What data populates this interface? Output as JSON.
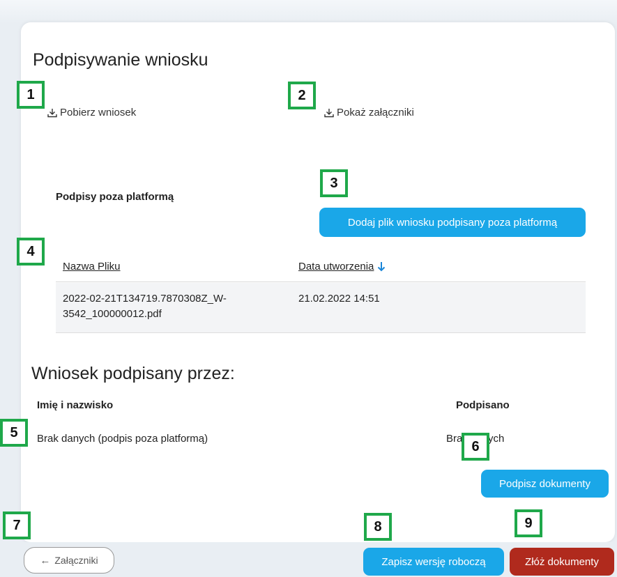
{
  "page": {
    "title": "Podpisywanie wniosku"
  },
  "downloads": {
    "download_application": "Pobierz wniosek",
    "show_attachments": "Pokaż załączniki"
  },
  "outside_signatures": {
    "label": "Podpisy poza platformą",
    "add_button": "Dodaj plik wniosku podpisany poza platformą"
  },
  "files_table": {
    "columns": [
      "Nazwa Pliku",
      "Data utworzenia"
    ],
    "rows": [
      {
        "name_line1": "2022-02-21T134719.7870308Z_W-",
        "name_line2": "3542_100000012.pdf",
        "date": "21.02.2022 14:51"
      }
    ]
  },
  "signed_by": {
    "title": "Wniosek podpisany przez:",
    "col_name": "Imię i nazwisko",
    "col_signed": "Podpisano",
    "row_name": "Brak danych (podpis poza platformą)",
    "row_signed": "Brak danych",
    "sign_button": "Podpisz dokumenty"
  },
  "footer": {
    "back_button": "Załączniki",
    "save_draft_button": "Zapisz wersję roboczą",
    "submit_button": "Złóż dokumenty"
  },
  "markers": [
    "1",
    "2",
    "3",
    "4",
    "5",
    "6",
    "7",
    "8",
    "9"
  ],
  "colors": {
    "accent_blue": "#1aa7e8",
    "submit_red": "#b02a1d",
    "marker_green": "#1fa84a"
  }
}
